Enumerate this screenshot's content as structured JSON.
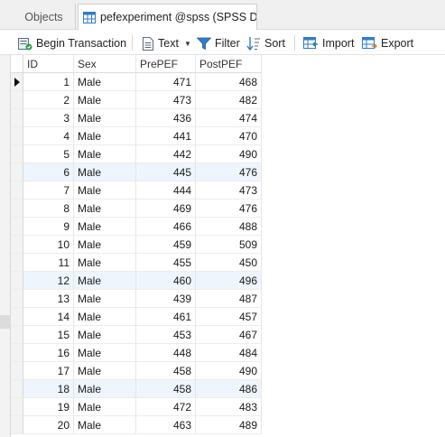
{
  "tabs": {
    "objects_label": "Objects",
    "active_label": "pefexperiment @spss (SPSS Da..."
  },
  "toolbar": {
    "begin_transaction": "Begin Transaction",
    "text": "Text",
    "filter": "Filter",
    "sort": "Sort",
    "import": "Import",
    "export": "Export"
  },
  "table": {
    "columns": [
      "ID",
      "Sex",
      "PrePEF",
      "PostPEF"
    ],
    "rows": [
      [
        "1",
        "Male",
        "471",
        "468"
      ],
      [
        "2",
        "Male",
        "473",
        "482"
      ],
      [
        "3",
        "Male",
        "436",
        "474"
      ],
      [
        "4",
        "Male",
        "441",
        "470"
      ],
      [
        "5",
        "Male",
        "442",
        "490"
      ],
      [
        "6",
        "Male",
        "445",
        "476"
      ],
      [
        "7",
        "Male",
        "444",
        "473"
      ],
      [
        "8",
        "Male",
        "469",
        "476"
      ],
      [
        "9",
        "Male",
        "466",
        "488"
      ],
      [
        "10",
        "Male",
        "459",
        "509"
      ],
      [
        "11",
        "Male",
        "455",
        "450"
      ],
      [
        "12",
        "Male",
        "460",
        "496"
      ],
      [
        "13",
        "Male",
        "439",
        "487"
      ],
      [
        "14",
        "Male",
        "461",
        "457"
      ],
      [
        "15",
        "Male",
        "453",
        "467"
      ],
      [
        "16",
        "Male",
        "448",
        "484"
      ],
      [
        "17",
        "Male",
        "458",
        "490"
      ],
      [
        "18",
        "Male",
        "458",
        "486"
      ],
      [
        "19",
        "Male",
        "472",
        "483"
      ],
      [
        "20",
        "Male",
        "463",
        "489"
      ]
    ],
    "highlighted_rows": [
      6,
      12,
      18
    ],
    "current_row": 1
  },
  "colors": {
    "highlight_row": "#eef5fd",
    "icon_blue": "#2f7cc8",
    "icon_teal": "#1a8a8a"
  }
}
